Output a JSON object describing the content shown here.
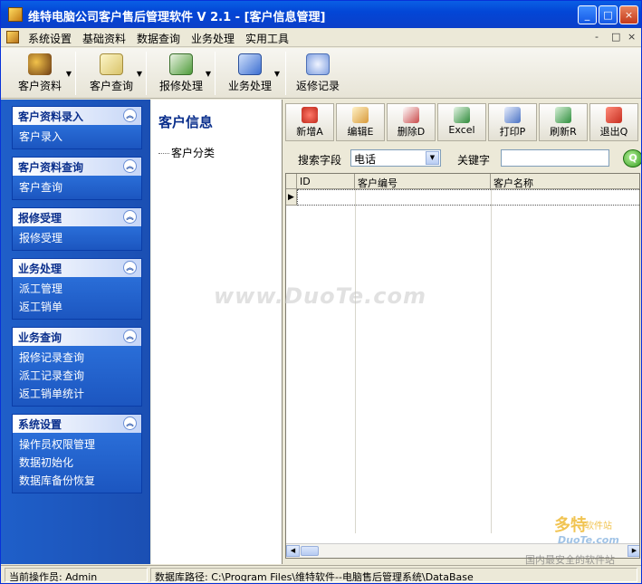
{
  "window": {
    "title": "维特电脑公司客户售后管理软件 V 2.1 - [客户信息管理]",
    "controls": {
      "minimize": "_",
      "maximize": "□",
      "close": "×"
    }
  },
  "menubar": {
    "items": [
      "系统设置",
      "基础资料",
      "数据查询",
      "业务处理",
      "实用工具"
    ],
    "mdi_controls": [
      "-",
      "□",
      "×"
    ]
  },
  "toolbar": {
    "items": [
      {
        "label": "客户资料",
        "icon": "customer-icon"
      },
      {
        "label": "客户查询",
        "icon": "query-icon"
      },
      {
        "label": "报修处理",
        "icon": "repair-icon"
      },
      {
        "label": "业务处理",
        "icon": "business-icon"
      },
      {
        "label": "返修记录",
        "icon": "record-icon"
      }
    ]
  },
  "sidebar": {
    "groups": [
      {
        "title": "客户资料录入",
        "items": [
          "客户录入"
        ]
      },
      {
        "title": "客户资料查询",
        "items": [
          "客户查询"
        ]
      },
      {
        "title": "报修受理",
        "items": [
          "报修受理"
        ]
      },
      {
        "title": "业务处理",
        "items": [
          "派工管理",
          "返工销单"
        ]
      },
      {
        "title": "业务查询",
        "items": [
          "报修记录查询",
          "派工记录查询",
          "返工销单统计"
        ]
      },
      {
        "title": "系统设置",
        "items": [
          "操作员权限管理",
          "数据初始化",
          "数据库备份恢复"
        ]
      }
    ]
  },
  "tree": {
    "title": "客户信息",
    "nodes": [
      "客户分类"
    ]
  },
  "actions": [
    {
      "label": "新增A",
      "icon": "add-icon",
      "color": "#d9362b"
    },
    {
      "label": "编辑E",
      "icon": "edit-icon",
      "color": "#d89a3a"
    },
    {
      "label": "删除D",
      "icon": "delete-icon",
      "color": "#c94a4a"
    },
    {
      "label": "Excel",
      "icon": "excel-icon",
      "color": "#2e8a3a"
    },
    {
      "label": "打印P",
      "icon": "print-icon",
      "color": "#4a72c4"
    },
    {
      "label": "刷新R",
      "icon": "refresh-icon",
      "color": "#2f8f3e"
    },
    {
      "label": "退出Q",
      "icon": "exit-icon",
      "color": "#c72e20"
    }
  ],
  "search": {
    "field_label": "搜索字段",
    "field_value": "电话",
    "keyword_label": "关键字",
    "keyword_value": ""
  },
  "grid": {
    "columns": [
      "ID",
      "客户编号",
      "客户名称"
    ],
    "rows": []
  },
  "statusbar": {
    "operator": "当前操作员: Admin",
    "db_path": "数据库路径: C:\\Program Files\\维特软件--电脑售后管理系统\\DataBase"
  },
  "watermark": {
    "main": "www.DuoTe.com",
    "brand": "多特",
    "brand_sub": "软件站",
    "url": "DuoTe.com",
    "slogan": "国内最安全的软件站"
  }
}
